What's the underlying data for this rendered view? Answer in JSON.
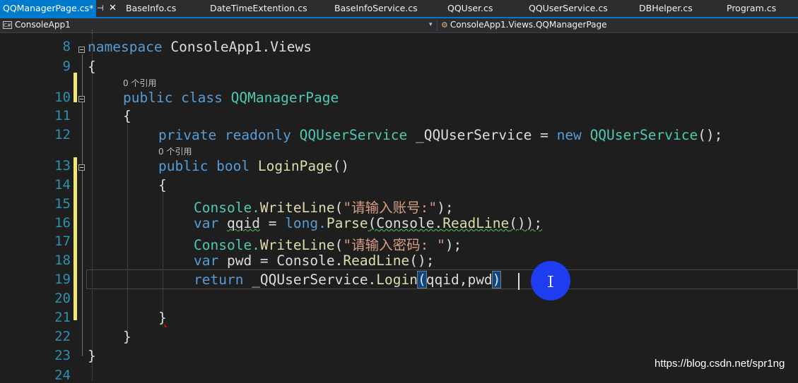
{
  "tabs": [
    {
      "label": "QQManagerPage.cs*",
      "active": true
    },
    {
      "label": "BaseInfo.cs"
    },
    {
      "label": "DateTimeExtention.cs"
    },
    {
      "label": "BaseInfoService.cs"
    },
    {
      "label": "QQUser.cs"
    },
    {
      "label": "QQUserService.cs"
    },
    {
      "label": "DBHelper.cs"
    },
    {
      "label": "Program.cs"
    }
  ],
  "tab_pin_glyph": "⊣",
  "tab_close_glyph": "✕",
  "navbar": {
    "project": "ConsoleApp1",
    "project_icon": "C#",
    "class": "ConsoleApp1.Views.QQManagerPage",
    "dropdown_glyph": "▾"
  },
  "editor": {
    "line_numbers": [
      "8",
      "9",
      "10",
      "11",
      "12",
      "13",
      "14",
      "15",
      "16",
      "17",
      "18",
      "19",
      "20",
      "21",
      "22",
      "23",
      "24"
    ],
    "reference_lens": [
      "0 个引用",
      "0 个引用"
    ],
    "code": {
      "l8": {
        "kw": "namespace",
        "name": " ConsoleApp1.Views"
      },
      "l9": "{",
      "l10": {
        "kw": "public class",
        "name": "QQManagerPage"
      },
      "l11": "{",
      "l12": {
        "kw1": "private readonly",
        "type": "QQUserService",
        "field": "_QQUserService",
        "eq": " = ",
        "kw2": "new",
        "type2": "QQUserService",
        "end": "();"
      },
      "l13": {
        "kw": "public bool",
        "name": "LoginPage",
        "end": "()"
      },
      "l14": "{",
      "l15": {
        "obj": "Console.",
        "fn": "WriteLine",
        "open": "(",
        "str": "\"请输入账号:\"",
        "end": ");"
      },
      "l16": {
        "kw": "var",
        "var": "qqid",
        "eq": " = ",
        "kw2": "long.",
        "fn": "Parse",
        "open": "(Console.",
        "fn2": "ReadLine",
        "end": "());"
      },
      "l17": {
        "obj": "Console.",
        "fn": "WriteLine",
        "open": "(",
        "str": "\"请输入密码: \"",
        "end": ");"
      },
      "l18": {
        "kw": "var",
        "rest": " pwd = Console.",
        "fn": "ReadLine",
        "end": "();"
      },
      "l19": {
        "kw": "return",
        "field": " _QQUserService.",
        "fn": "Login",
        "open": "(",
        "args": "qqid,pwd",
        "close": ")"
      },
      "l21": "}",
      "l22": "}",
      "l23": "}"
    }
  },
  "watermark": "https://blog.csdn.net/spr1ng",
  "colors": {
    "tab_active": "#007acc",
    "keyword": "#569cd6",
    "type": "#4ec9b0",
    "method": "#dcdcaa",
    "string": "#d69d85",
    "line_number": "#2b91af",
    "change_marker": "#efe771",
    "click_indicator": "#1e3cf0"
  }
}
